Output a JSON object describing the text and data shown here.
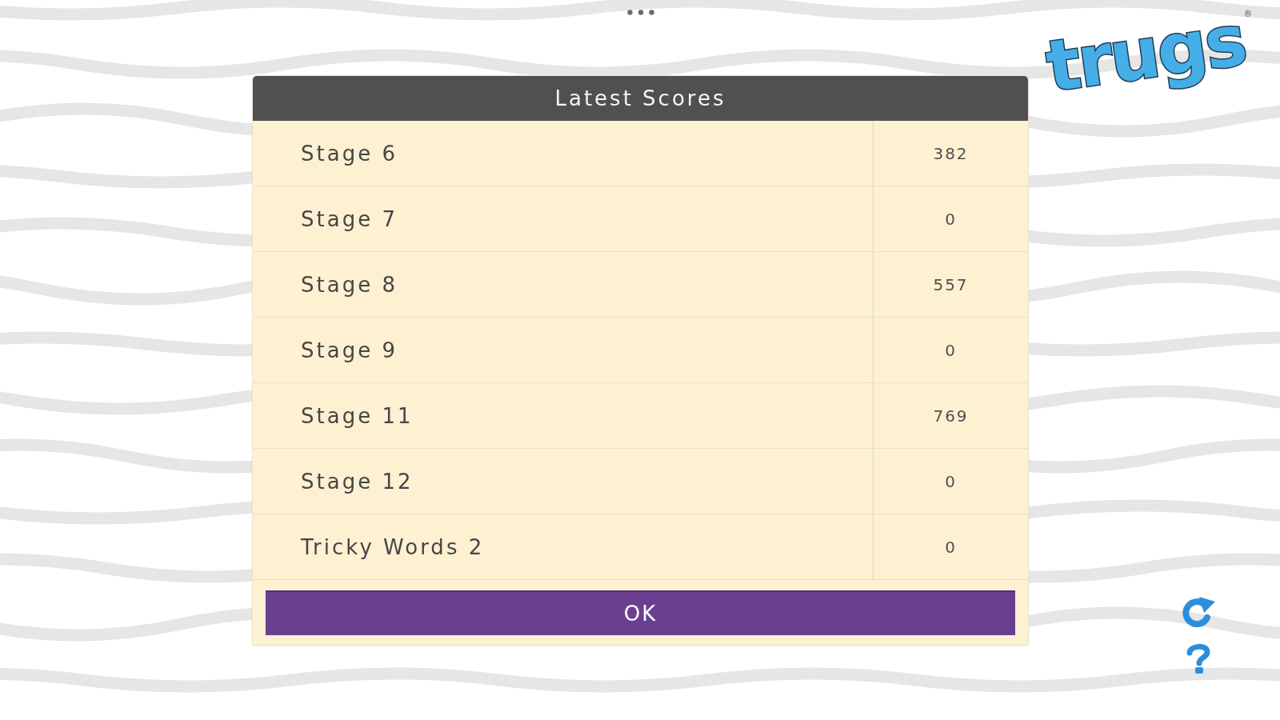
{
  "dialog": {
    "title": "Latest Scores",
    "rows": [
      {
        "label": "Stage 6",
        "score": "382"
      },
      {
        "label": "Stage 7",
        "score": "0"
      },
      {
        "label": "Stage 8",
        "score": "557"
      },
      {
        "label": "Stage 9",
        "score": "0"
      },
      {
        "label": "Stage 11",
        "score": "769"
      },
      {
        "label": "Stage 12",
        "score": "0"
      },
      {
        "label": "Tricky Words 2",
        "score": "0"
      }
    ],
    "ok_button": "OK"
  },
  "logo": {
    "text": "trugs",
    "mark": "®"
  }
}
